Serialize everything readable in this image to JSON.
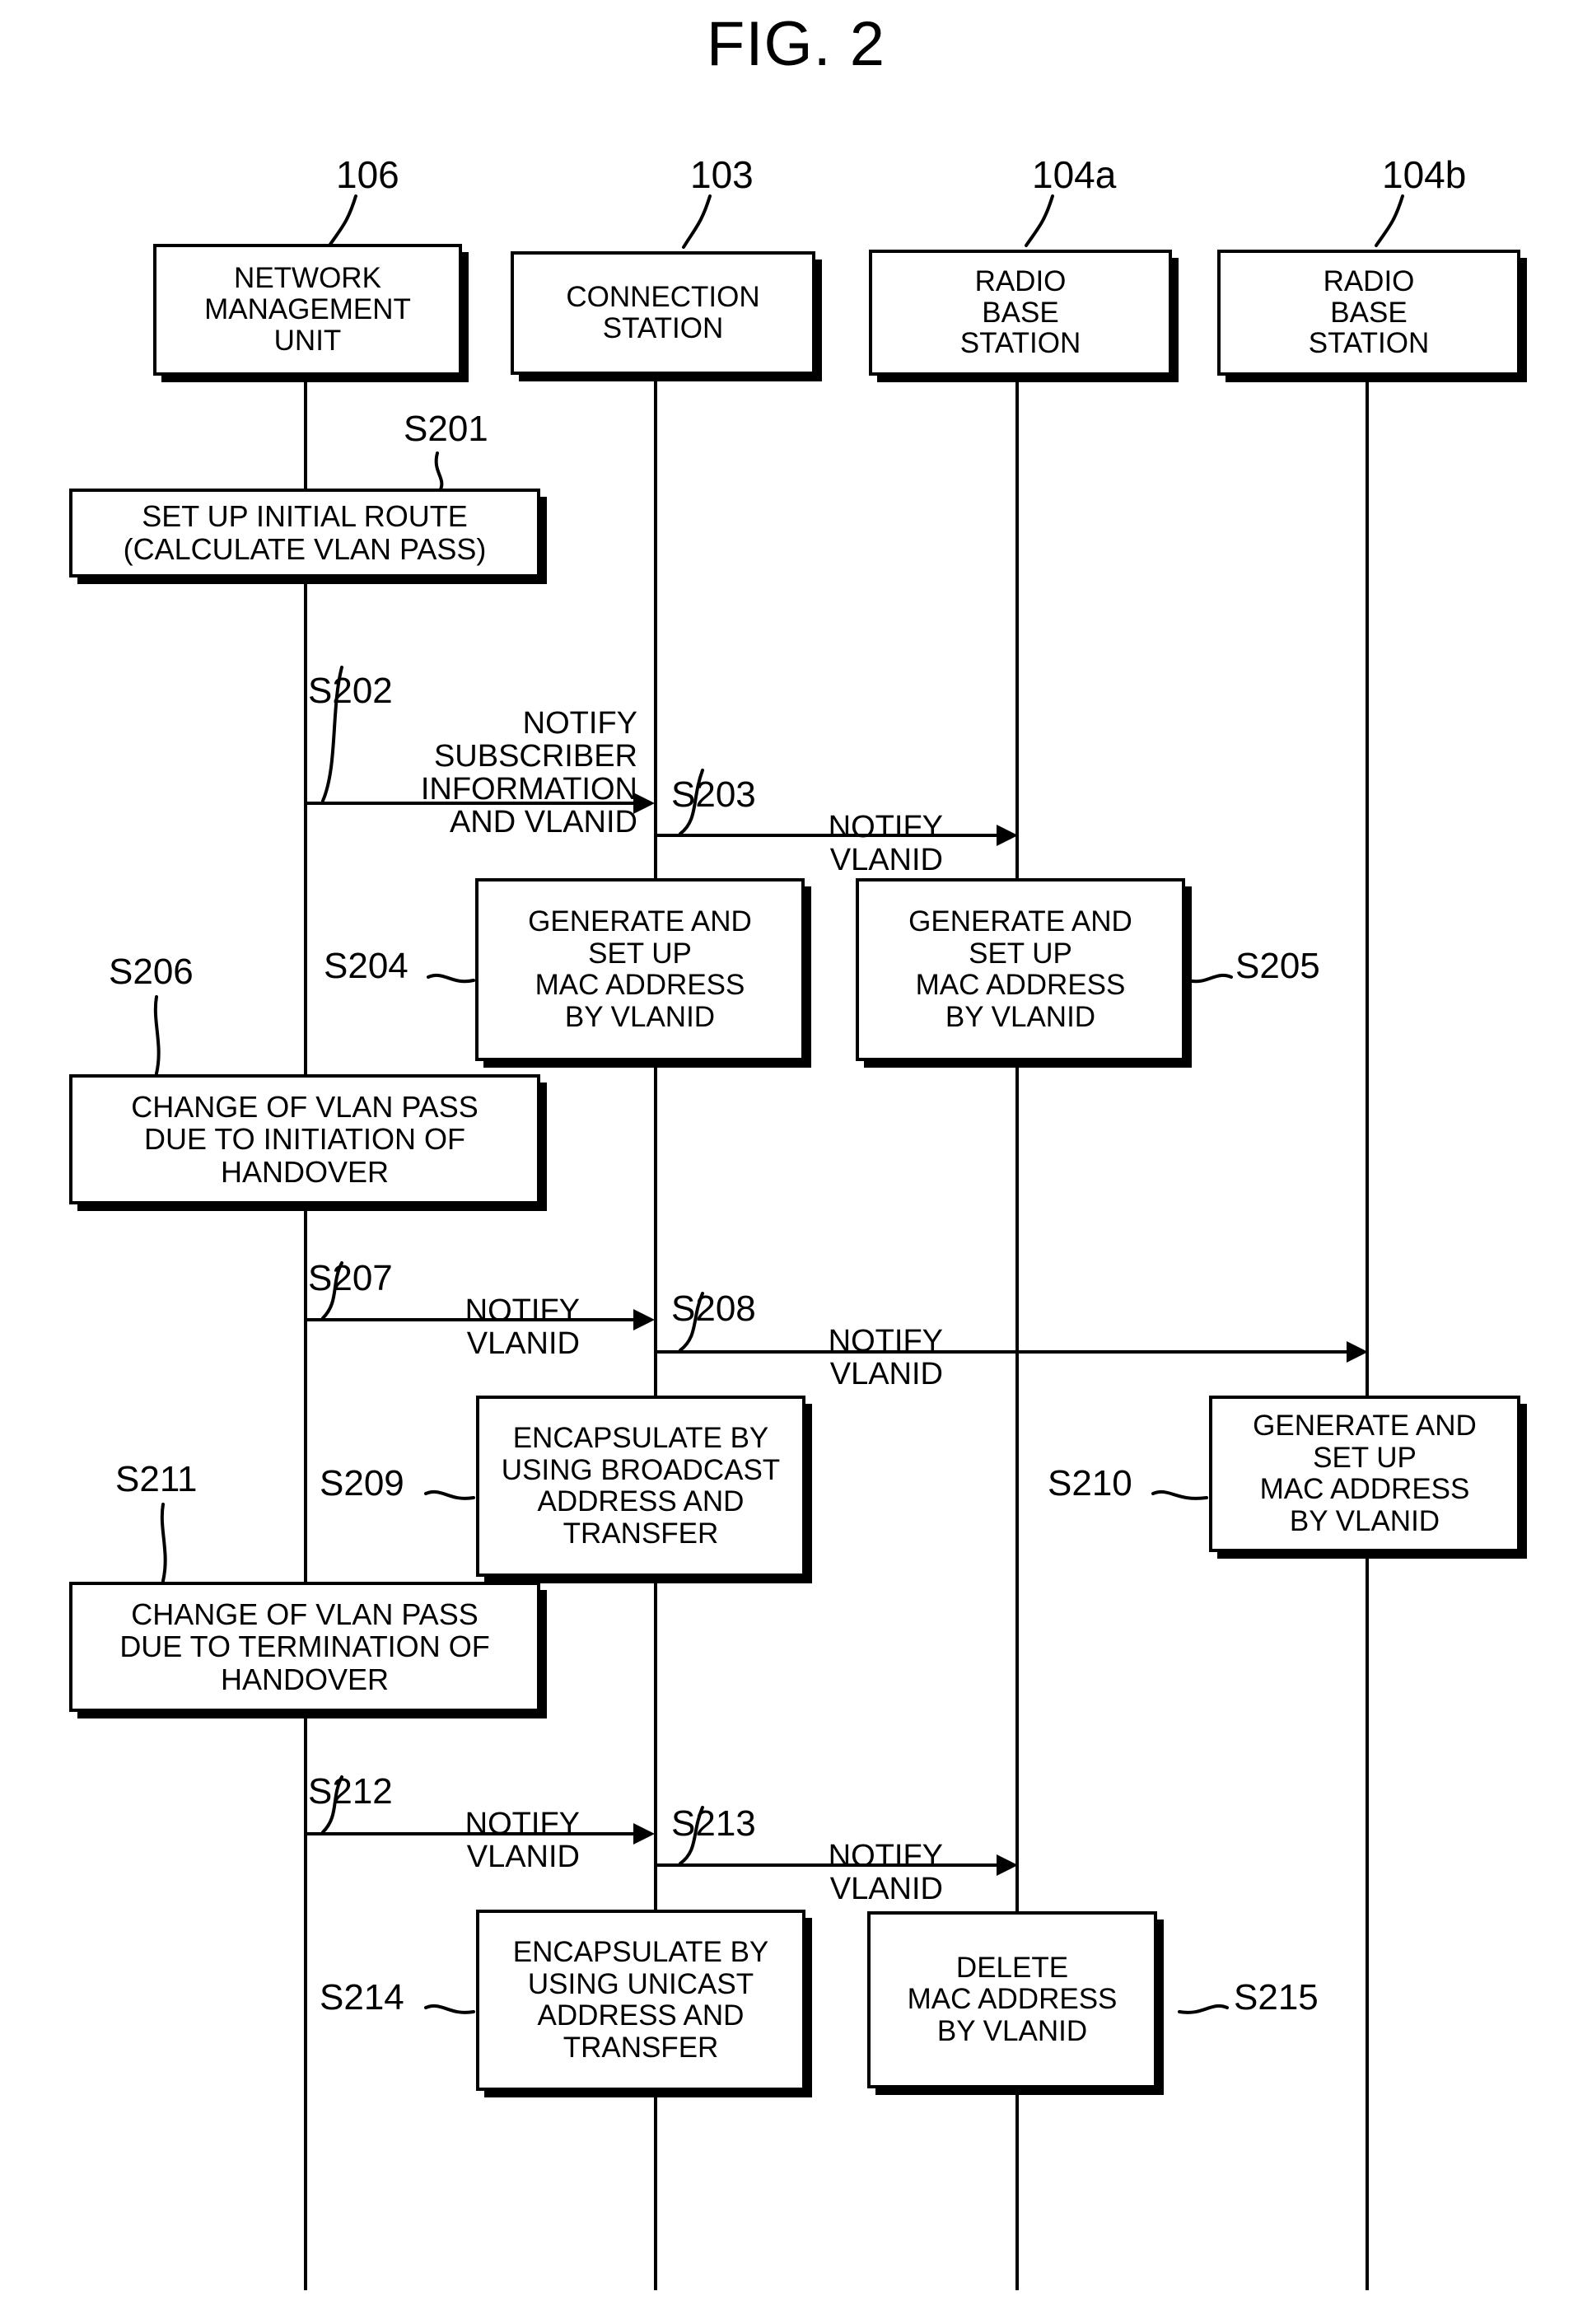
{
  "figure": {
    "title": "FIG. 2",
    "type": "sequence-diagram"
  },
  "actors": [
    {
      "ref": "106",
      "label": "NETWORK\nMANAGEMENT\nUNIT"
    },
    {
      "ref": "103",
      "label": "CONNECTION\nSTATION"
    },
    {
      "ref": "104a",
      "label": "RADIO\nBASE\nSTATION"
    },
    {
      "ref": "104b",
      "label": "RADIO\nBASE\nSTATION"
    }
  ],
  "steps": [
    {
      "id": "S201",
      "kind": "process",
      "actor": "106",
      "label": "SET UP INITIAL ROUTE\n(CALCULATE VLAN PASS)"
    },
    {
      "id": "S202",
      "kind": "message",
      "from": "106",
      "to": "103",
      "label": "NOTIFY\nSUBSCRIBER\nINFORMATION\nAND VLANID"
    },
    {
      "id": "S203",
      "kind": "message",
      "from": "103",
      "to": "104a",
      "label": "NOTIFY\nVLANID"
    },
    {
      "id": "S204",
      "kind": "process",
      "actor": "103",
      "label": "GENERATE AND\nSET UP\nMAC ADDRESS\nBY VLANID"
    },
    {
      "id": "S205",
      "kind": "process",
      "actor": "104a",
      "label": "GENERATE AND\nSET UP\nMAC ADDRESS\nBY VLANID"
    },
    {
      "id": "S206",
      "kind": "process",
      "actor": "106",
      "label": "CHANGE OF VLAN PASS\nDUE TO INITIATION OF\nHANDOVER"
    },
    {
      "id": "S207",
      "kind": "message",
      "from": "106",
      "to": "103",
      "label": "NOTIFY\nVLANID"
    },
    {
      "id": "S208",
      "kind": "message",
      "from": "103",
      "to": "104b",
      "label": "NOTIFY\nVLANID"
    },
    {
      "id": "S209",
      "kind": "process",
      "actor": "103",
      "label": "ENCAPSULATE BY\nUSING BROADCAST\nADDRESS AND\nTRANSFER"
    },
    {
      "id": "S210",
      "kind": "process",
      "actor": "104b",
      "label": "GENERATE AND\nSET UP\nMAC ADDRESS\nBY VLANID"
    },
    {
      "id": "S211",
      "kind": "process",
      "actor": "106",
      "label": "CHANGE OF VLAN PASS\nDUE TO TERMINATION OF\nHANDOVER"
    },
    {
      "id": "S212",
      "kind": "message",
      "from": "106",
      "to": "103",
      "label": "NOTIFY\nVLANID"
    },
    {
      "id": "S213",
      "kind": "message",
      "from": "103",
      "to": "104a",
      "label": "NOTIFY\nVLANID"
    },
    {
      "id": "S214",
      "kind": "process",
      "actor": "103",
      "label": "ENCAPSULATE BY\nUSING UNICAST\nADDRESS AND\nTRANSFER"
    },
    {
      "id": "S215",
      "kind": "process",
      "actor": "104a",
      "label": "DELETE\nMAC ADDRESS\nBY VLANID"
    }
  ],
  "labels": {
    "s202_num": "S202",
    "s202_text": "NOTIFY\nSUBSCRIBER\nINFORMATION\nAND VLANID",
    "s203_num": "S203",
    "s203_text": "NOTIFY\nVLANID",
    "s207_num": "S207",
    "s207_text": "NOTIFY\nVLANID",
    "s208_num": "S208",
    "s208_text": "NOTIFY\nVLANID",
    "s212_num": "S212",
    "s212_text": "NOTIFY\nVLANID",
    "s213_num": "S213",
    "s213_text": "NOTIFY\nVLANID"
  }
}
